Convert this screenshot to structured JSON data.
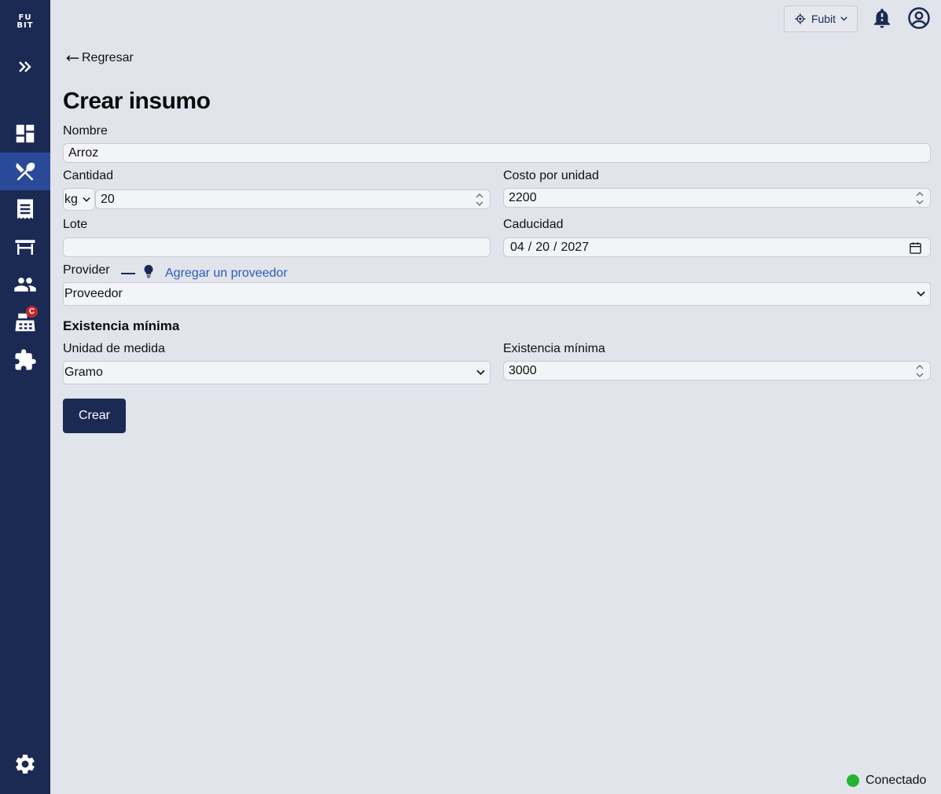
{
  "logo": {
    "line1": "FU",
    "line2": "BIT"
  },
  "sidebar": {
    "items": [
      {
        "name": "dashboard"
      },
      {
        "name": "insumos",
        "active": true
      },
      {
        "name": "orders"
      },
      {
        "name": "tables"
      },
      {
        "name": "users"
      },
      {
        "name": "cash-register",
        "badge": "C"
      },
      {
        "name": "extensions"
      }
    ]
  },
  "topbar": {
    "location_label": "Fubit"
  },
  "page": {
    "back_label": "Regresar",
    "title": "Crear insumo"
  },
  "form": {
    "nombre": {
      "label": "Nombre",
      "value": "Arroz"
    },
    "cantidad": {
      "label": "Cantidad",
      "unit": "kg",
      "value": "20"
    },
    "costo": {
      "label": "Costo por unidad",
      "value": "2200"
    },
    "lote": {
      "label": "Lote",
      "value": ""
    },
    "caducidad": {
      "label": "Caducidad",
      "month": "04",
      "day": "20",
      "year": "2027",
      "sep": "/"
    },
    "provider": {
      "label": "Provider",
      "add_label": "Agregar un proveedor",
      "value": "Proveedor"
    },
    "existencia": {
      "section_title": "Existencia mínima",
      "unidad_label": "Unidad de medida",
      "unidad_value": "Gramo",
      "minima_label": "Existencia mínima",
      "minima_value": "3000"
    },
    "submit_label": "Crear"
  },
  "status": {
    "label": "Conectado",
    "color": "#22b533"
  },
  "colors": {
    "sidebar": "#1b2a53",
    "active": "#2a4a99",
    "background": "#e1e4eb",
    "link": "#2b5bb5"
  }
}
